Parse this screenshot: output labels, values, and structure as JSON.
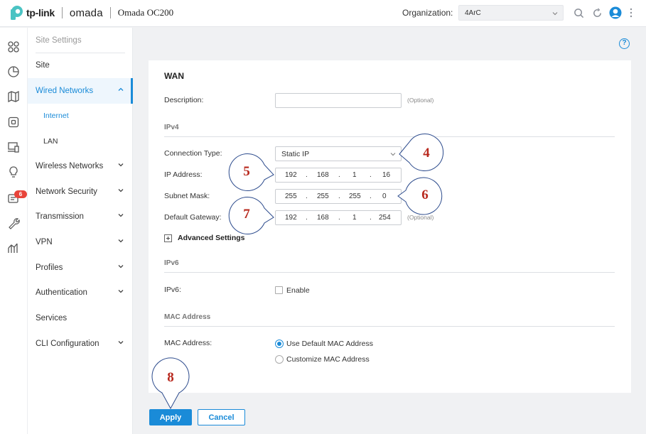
{
  "header": {
    "brand": "tp-link",
    "product_family": "omada",
    "product": "Omada OC200",
    "org_label": "Organization:",
    "org_value": "4ArC"
  },
  "icons": {
    "top": [
      "chevron-down-icon",
      "search-icon",
      "refresh-icon",
      "user-avatar-icon",
      "more-vertical-icon"
    ],
    "rail": [
      "dashboard-icon",
      "statistics-icon",
      "map-icon",
      "devices-icon",
      "clients-icon",
      "insight-icon",
      "logs-icon",
      "tools-icon",
      "reports-icon"
    ]
  },
  "rail_badge": "6",
  "menu": {
    "items": [
      {
        "label": "Site Settings",
        "kind": "head",
        "chevron": false
      },
      {
        "label": "Site",
        "kind": "item",
        "chevron": false
      },
      {
        "label": "Wired Networks",
        "kind": "active",
        "chevron": true
      },
      {
        "label": "Internet",
        "kind": "sub-active",
        "chevron": false
      },
      {
        "label": "LAN",
        "kind": "sub",
        "chevron": false
      },
      {
        "label": "Wireless Networks",
        "kind": "item",
        "chevron": true
      },
      {
        "label": "Network Security",
        "kind": "item",
        "chevron": true
      },
      {
        "label": "Transmission",
        "kind": "item",
        "chevron": true
      },
      {
        "label": "VPN",
        "kind": "item",
        "chevron": true
      },
      {
        "label": "Profiles",
        "kind": "item",
        "chevron": true
      },
      {
        "label": "Authentication",
        "kind": "item",
        "chevron": true
      },
      {
        "label": "Services",
        "kind": "item",
        "chevron": false
      },
      {
        "label": "CLI Configuration",
        "kind": "item",
        "chevron": true
      }
    ]
  },
  "help": "?",
  "form": {
    "title": "WAN",
    "description_label": "Description:",
    "description_value": "",
    "optional": "(Optional)",
    "ipv4_section": "IPv4",
    "connection_type_label": "Connection Type:",
    "connection_type_value": "Static IP",
    "ip_label": "IP Address:",
    "ip": [
      "192",
      "168",
      "1",
      "16"
    ],
    "mask_label": "Subnet Mask:",
    "mask": [
      "255",
      "255",
      "255",
      "0"
    ],
    "gateway_label": "Default Gateway:",
    "gateway": [
      "192",
      "168",
      "1",
      "254"
    ],
    "advanced": "Advanced Settings",
    "ipv6_section": "IPv6",
    "ipv6_label": "IPv6:",
    "ipv6_enable": "Enable",
    "mac_section": "MAC Address",
    "mac_label": "MAC Address:",
    "mac_default": "Use Default MAC Address",
    "mac_custom": "Customize MAC Address"
  },
  "actions": {
    "apply": "Apply",
    "cancel": "Cancel"
  },
  "callouts": [
    "4",
    "5",
    "6",
    "7",
    "8"
  ],
  "colors": {
    "accent": "#1a8bd8",
    "callout": "#b8281d",
    "badge": "#e8443a"
  }
}
